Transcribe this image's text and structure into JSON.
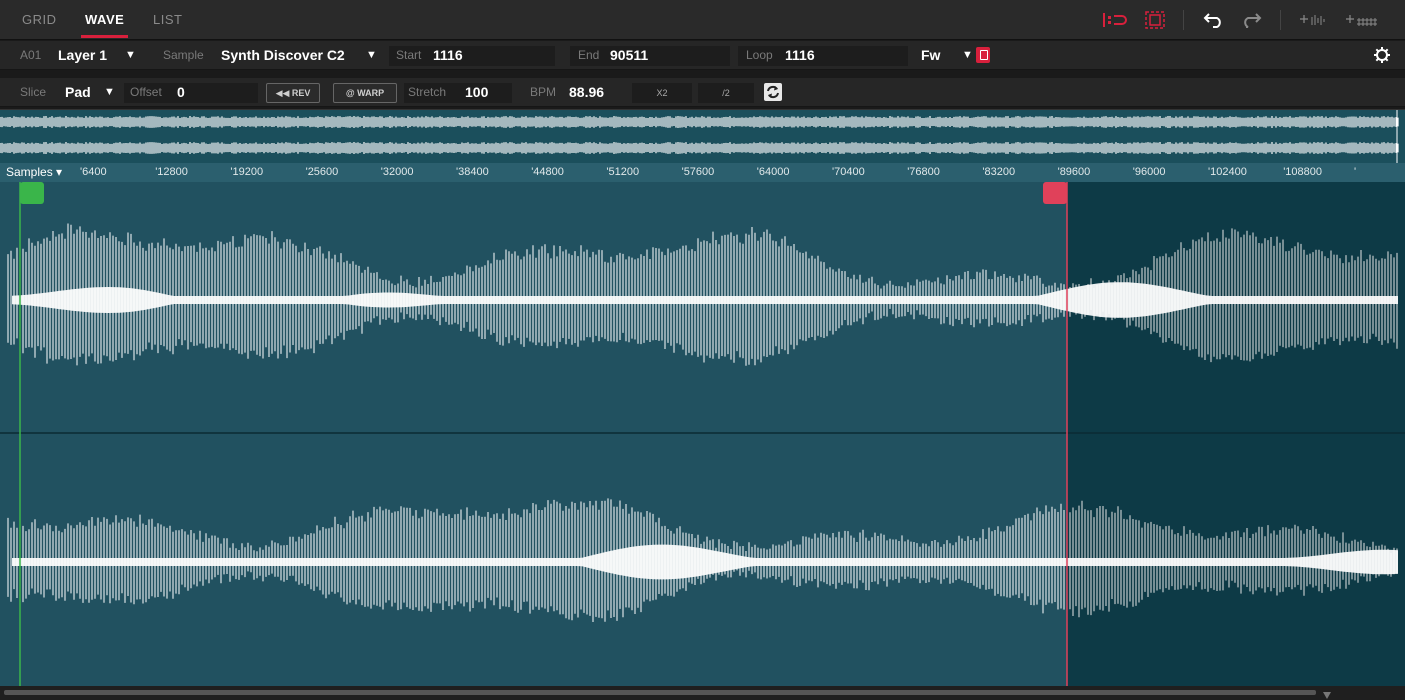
{
  "tabs": [
    {
      "label": "GRID",
      "active": false
    },
    {
      "label": "WAVE",
      "active": true
    },
    {
      "label": "LIST",
      "active": false
    }
  ],
  "toolbar_icons": [
    "snap-icon",
    "select-all-icon",
    "undo-icon",
    "redo-icon",
    "zoom-in-icon",
    "zoom-out-icon"
  ],
  "row1": {
    "program_id": "A01",
    "layer": "Layer 1",
    "sample_label": "Sample",
    "sample": "Synth Discover C2",
    "start_label": "Start",
    "start": "1116",
    "end_label": "End",
    "end": "90511",
    "loop_label": "Loop",
    "loop": "1116",
    "direction": "Fw"
  },
  "row2": {
    "slice_label": "Slice",
    "slice": "Pad",
    "offset_label": "Offset",
    "offset": "0",
    "rev_label": "◀◀ REV",
    "warp_label": "@ WARP",
    "stretch_label": "Stretch",
    "stretch": "100",
    "bpm_label": "BPM",
    "bpm": "88.96",
    "x2_label": "X2",
    "div2_label": "/2"
  },
  "ruler": {
    "unit": "Samples",
    "ticks": [
      "'6400",
      "'12800",
      "'19200",
      "'25600",
      "'32000",
      "'38400",
      "'44800",
      "'51200",
      "'57600",
      "'64000",
      "'70400",
      "'76800",
      "'83200",
      "'89600",
      "'96000",
      "'102400",
      "'108800"
    ]
  },
  "colors": {
    "accent": "#d8203c",
    "start_marker": "#3ab54a",
    "end_marker": "#e0415a",
    "wave_bg": "#215160",
    "wave_bg_after_end": "#0d3a46",
    "waveform": "#ffffff"
  }
}
